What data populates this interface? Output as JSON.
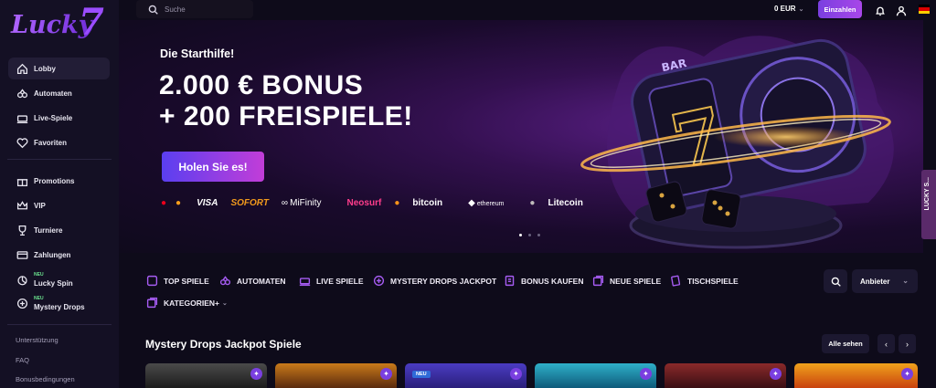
{
  "brand": {
    "logo_text": "Lucky7"
  },
  "sidebar": {
    "items": [
      {
        "label": "Lobby",
        "icon": "home-icon",
        "active": true
      },
      {
        "label": "Automaten",
        "icon": "slots-icon"
      },
      {
        "label": "Live-Spiele",
        "icon": "live-icon"
      },
      {
        "label": "Favoriten",
        "icon": "heart-icon"
      },
      {
        "label": "Promotions",
        "icon": "gift-icon"
      },
      {
        "label": "VIP",
        "icon": "crown-icon"
      },
      {
        "label": "Turniere",
        "icon": "trophy-icon"
      },
      {
        "label": "Zahlungen",
        "icon": "card-icon"
      },
      {
        "label": "Lucky Spin",
        "icon": "spin-icon",
        "badge": "NEU"
      },
      {
        "label": "Mystery Drops",
        "icon": "plus-circle-icon",
        "badge": "NEU"
      }
    ],
    "links": [
      "Unterstützung",
      "FAQ",
      "Bonusbedingungen"
    ]
  },
  "header": {
    "search_placeholder": "Suche",
    "balance": "0 EUR",
    "deposit_label": "Einzahlen"
  },
  "hero": {
    "subtitle": "Die Starthilfe!",
    "title_line1": "2.000 € BONUS",
    "title_line2": "+ 200 FREISPIELE!",
    "cta_label": "Holen Sie es!",
    "payments": [
      "VISA",
      "SOFORT",
      "MiFinity",
      "Neosurf",
      "bitcoin",
      "ethereum",
      "Litecoin"
    ],
    "slide_count": 3,
    "active_slide": 1,
    "side_tab": "LUCKY S..."
  },
  "categories": {
    "items": [
      "TOP SPIELE",
      "AUTOMATEN",
      "LIVE SPIELE",
      "MYSTERY DROPS JACKPOT",
      "BONUS KAUFEN",
      "NEUE SPIELE",
      "TISCHSPIELE",
      "KATEGORIEN+"
    ],
    "provider_label": "Anbieter"
  },
  "section": {
    "title": "Mystery Drops Jackpot Spiele",
    "see_all": "Alle sehen",
    "prev": "‹",
    "next": "›",
    "tile_badge": "✦",
    "new_badge": "NEU"
  },
  "colors": {
    "accent": "#7a3fe0",
    "cta_start": "#5a3ff0",
    "cta_end": "#c23dd8",
    "neu": "#6be38f"
  }
}
